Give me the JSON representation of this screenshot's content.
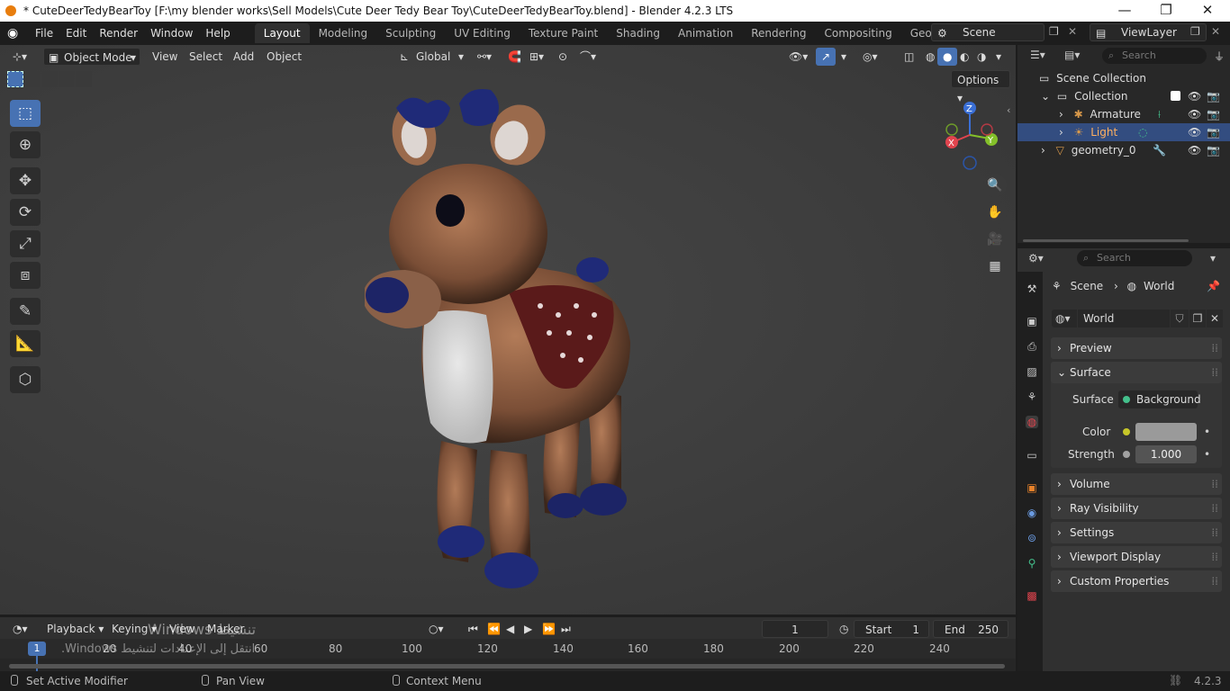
{
  "window": {
    "title": "* CuteDeerTedyBearToy [F:\\my blender works\\Sell Models\\Cute Deer Tedy Bear Toy\\CuteDeerTedyBearToy.blend] - Blender 4.2.3 LTS",
    "minimize": "—",
    "maximize": "❐",
    "close": "✕"
  },
  "menus": [
    "File",
    "Edit",
    "Render",
    "Window",
    "Help"
  ],
  "workspaces": [
    "Layout",
    "Modeling",
    "Sculpting",
    "UV Editing",
    "Texture Paint",
    "Shading",
    "Animation",
    "Rendering",
    "Compositing",
    "Geometry Nodes"
  ],
  "active_workspace": "Layout",
  "scene": "Scene",
  "view_layer": "ViewLayer",
  "viewport_header": {
    "mode": "Object Mode",
    "menus": [
      "View",
      "Select",
      "Add",
      "Object"
    ],
    "orientation": "Global",
    "options": "Options"
  },
  "outliner": {
    "search_placeholder": "Search",
    "items": [
      {
        "label": "Scene Collection"
      },
      {
        "label": "Collection"
      },
      {
        "label": "Armature"
      },
      {
        "label": "Light"
      },
      {
        "label": "geometry_0"
      }
    ]
  },
  "properties": {
    "search_placeholder": "Search",
    "breadcrumb_scene": "Scene",
    "breadcrumb_world": "World",
    "world_name": "World",
    "panels": {
      "preview": "Preview",
      "surface": "Surface",
      "volume": "Volume",
      "ray_visibility": "Ray Visibility",
      "settings": "Settings",
      "viewport_display": "Viewport Display",
      "custom_properties": "Custom Properties"
    },
    "surface_label": "Surface",
    "surface_value": "Background",
    "color_label": "Color",
    "color_value": "#9a9a9a",
    "strength_label": "Strength",
    "strength_value": "1.000"
  },
  "timeline": {
    "menus": [
      "Playback",
      "Keying",
      "View",
      "Marker"
    ],
    "current_frame": "1",
    "start_label": "Start",
    "start_value": "1",
    "end_label": "End",
    "end_value": "250",
    "ticks": [
      "1",
      "20",
      "40",
      "60",
      "80",
      "100",
      "120",
      "140",
      "160",
      "180",
      "200",
      "220",
      "240"
    ]
  },
  "watermark": {
    "line1": "تنشيط Windows",
    "line2": "انتقل إلى الإعدادات لتنشيط Windows."
  },
  "statusbar": {
    "hint1": "Set Active Modifier",
    "hint2": "Pan View",
    "hint3": "Context Menu",
    "version": "4.2.3"
  },
  "colors": {
    "accent": "#4772b3",
    "selected_row": "#334d80",
    "axis_x": "#e0444e",
    "axis_y": "#84c02a",
    "axis_z": "#3a6fd6"
  }
}
